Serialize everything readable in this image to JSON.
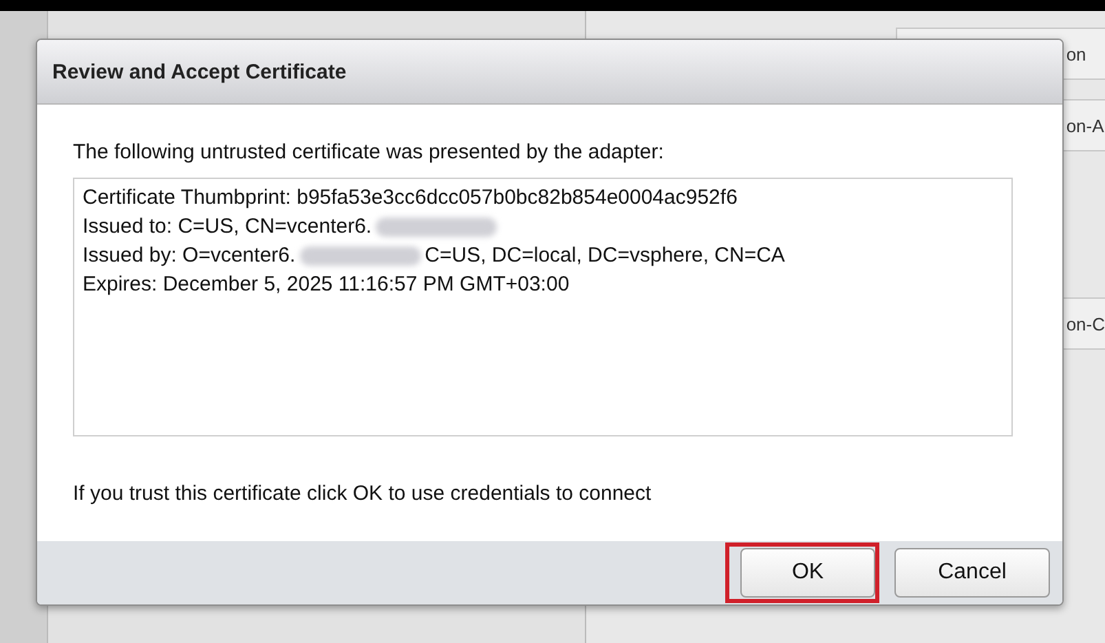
{
  "background": {
    "fragments": [
      "on",
      "on-A",
      "on-C"
    ]
  },
  "dialog": {
    "title": "Review and Accept Certificate",
    "intro": "The following untrusted certificate was presented by the adapter:",
    "certificate_lines": [
      {
        "text": "Certificate Thumbprint: b95fa53e3cc6dcc057b0bc82b854e0004ac952f6",
        "redacted": false
      },
      {
        "text": "Issued to: C=US, CN=vcenter6.",
        "redacted": true
      },
      {
        "text": "Issued by: O=vcenter6.",
        "redacted": true,
        "after": "C=US, DC=local, DC=vsphere, CN=CA"
      },
      {
        "text": "Expires: December 5, 2025 11:16:57 PM GMT+03:00",
        "redacted": false
      }
    ],
    "prompt": "If you trust this certificate click OK to use credentials to connect",
    "buttons": [
      {
        "label": "OK",
        "highlighted": true
      },
      {
        "label": "Cancel",
        "highlighted": false
      }
    ]
  }
}
